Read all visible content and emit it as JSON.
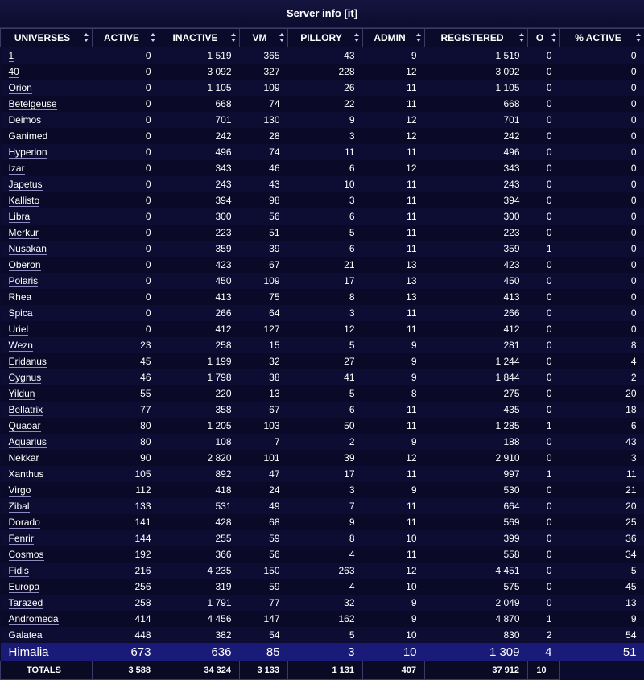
{
  "title": "Server info  [it]",
  "columns": [
    "UNIVERSES",
    "ACTIVE",
    "INACTIVE",
    "VM",
    "PILLORY",
    "ADMIN",
    "REGISTERED",
    "O",
    "% ACTIVE"
  ],
  "rows": [
    [
      "1",
      "0",
      "1 519",
      "365",
      "43",
      "9",
      "1 519",
      "0",
      "0"
    ],
    [
      "40",
      "0",
      "3 092",
      "327",
      "228",
      "12",
      "3 092",
      "0",
      "0"
    ],
    [
      "Orion",
      "0",
      "1 105",
      "109",
      "26",
      "11",
      "1 105",
      "0",
      "0"
    ],
    [
      "Betelgeuse",
      "0",
      "668",
      "74",
      "22",
      "11",
      "668",
      "0",
      "0"
    ],
    [
      "Deimos",
      "0",
      "701",
      "130",
      "9",
      "12",
      "701",
      "0",
      "0"
    ],
    [
      "Ganimed",
      "0",
      "242",
      "28",
      "3",
      "12",
      "242",
      "0",
      "0"
    ],
    [
      "Hyperion",
      "0",
      "496",
      "74",
      "11",
      "11",
      "496",
      "0",
      "0"
    ],
    [
      "Izar",
      "0",
      "343",
      "46",
      "6",
      "12",
      "343",
      "0",
      "0"
    ],
    [
      "Japetus",
      "0",
      "243",
      "43",
      "10",
      "11",
      "243",
      "0",
      "0"
    ],
    [
      "Kallisto",
      "0",
      "394",
      "98",
      "3",
      "11",
      "394",
      "0",
      "0"
    ],
    [
      "Libra",
      "0",
      "300",
      "56",
      "6",
      "11",
      "300",
      "0",
      "0"
    ],
    [
      "Merkur",
      "0",
      "223",
      "51",
      "5",
      "11",
      "223",
      "0",
      "0"
    ],
    [
      "Nusakan",
      "0",
      "359",
      "39",
      "6",
      "11",
      "359",
      "1",
      "0"
    ],
    [
      "Oberon",
      "0",
      "423",
      "67",
      "21",
      "13",
      "423",
      "0",
      "0"
    ],
    [
      "Polaris",
      "0",
      "450",
      "109",
      "17",
      "13",
      "450",
      "0",
      "0"
    ],
    [
      "Rhea",
      "0",
      "413",
      "75",
      "8",
      "13",
      "413",
      "0",
      "0"
    ],
    [
      "Spica",
      "0",
      "266",
      "64",
      "3",
      "11",
      "266",
      "0",
      "0"
    ],
    [
      "Uriel",
      "0",
      "412",
      "127",
      "12",
      "11",
      "412",
      "0",
      "0"
    ],
    [
      "Wezn",
      "23",
      "258",
      "15",
      "5",
      "9",
      "281",
      "0",
      "8"
    ],
    [
      "Eridanus",
      "45",
      "1 199",
      "32",
      "27",
      "9",
      "1 244",
      "0",
      "4"
    ],
    [
      "Cygnus",
      "46",
      "1 798",
      "38",
      "41",
      "9",
      "1 844",
      "0",
      "2"
    ],
    [
      "Yildun",
      "55",
      "220",
      "13",
      "5",
      "8",
      "275",
      "0",
      "20"
    ],
    [
      "Bellatrix",
      "77",
      "358",
      "67",
      "6",
      "11",
      "435",
      "0",
      "18"
    ],
    [
      "Quaoar",
      "80",
      "1 205",
      "103",
      "50",
      "11",
      "1 285",
      "1",
      "6"
    ],
    [
      "Aquarius",
      "80",
      "108",
      "7",
      "2",
      "9",
      "188",
      "0",
      "43"
    ],
    [
      "Nekkar",
      "90",
      "2 820",
      "101",
      "39",
      "12",
      "2 910",
      "0",
      "3"
    ],
    [
      "Xanthus",
      "105",
      "892",
      "47",
      "17",
      "11",
      "997",
      "1",
      "11"
    ],
    [
      "Virgo",
      "112",
      "418",
      "24",
      "3",
      "9",
      "530",
      "0",
      "21"
    ],
    [
      "Zibal",
      "133",
      "531",
      "49",
      "7",
      "11",
      "664",
      "0",
      "20"
    ],
    [
      "Dorado",
      "141",
      "428",
      "68",
      "9",
      "11",
      "569",
      "0",
      "25"
    ],
    [
      "Fenrir",
      "144",
      "255",
      "59",
      "8",
      "10",
      "399",
      "0",
      "36"
    ],
    [
      "Cosmos",
      "192",
      "366",
      "56",
      "4",
      "11",
      "558",
      "0",
      "34"
    ],
    [
      "Fidis",
      "216",
      "4 235",
      "150",
      "263",
      "12",
      "4 451",
      "0",
      "5"
    ],
    [
      "Europa",
      "256",
      "319",
      "59",
      "4",
      "10",
      "575",
      "0",
      "45"
    ],
    [
      "Tarazed",
      "258",
      "1 791",
      "77",
      "32",
      "9",
      "2 049",
      "0",
      "13"
    ],
    [
      "Andromeda",
      "414",
      "4 456",
      "147",
      "162",
      "9",
      "4 870",
      "1",
      "9"
    ],
    [
      "Galatea",
      "448",
      "382",
      "54",
      "5",
      "10",
      "830",
      "2",
      "54"
    ]
  ],
  "highlight": [
    "Himalia",
    "673",
    "636",
    "85",
    "3",
    "10",
    "1 309",
    "4",
    "51"
  ],
  "totals": [
    "TOTALS",
    "3 588",
    "34 324",
    "3 133",
    "1 131",
    "407",
    "37 912",
    "10"
  ],
  "colors": {
    "background": "#0b0b2e",
    "highlight": "#1a1a78",
    "border": "#3a3a66"
  }
}
